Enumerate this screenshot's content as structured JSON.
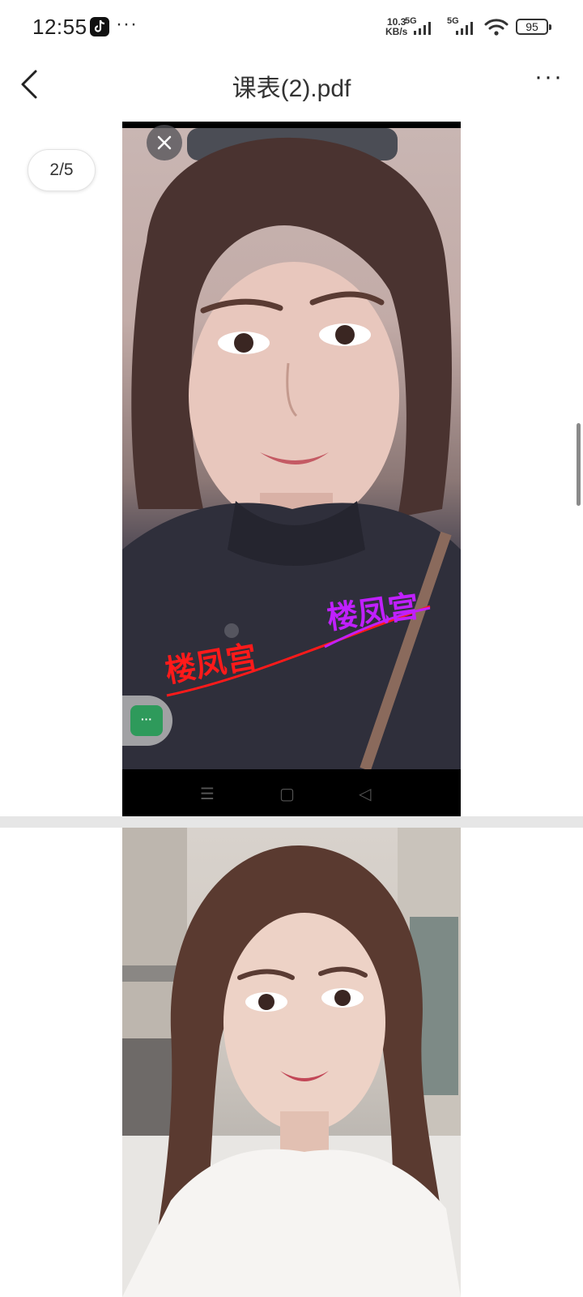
{
  "status_bar": {
    "time": "12:55",
    "more": "···",
    "net_speed_value": "10.3",
    "net_speed_unit": "KB/s",
    "sim1_label": "5G",
    "sim2_label": "5G",
    "battery": "95"
  },
  "header": {
    "title": "课表(2).pdf",
    "menu": "···"
  },
  "viewer": {
    "page_indicator": "2/5",
    "float_button": "···",
    "watermark_text": "楼凤宫",
    "colors": {
      "watermark_red": "#ff1a1a",
      "watermark_purple": "#c020ff",
      "float_green": "#2e9a5b"
    }
  },
  "icons": {
    "back": "chevron-left-icon",
    "menu": "more-horizontal-icon",
    "close": "close-icon",
    "app": "tiktok-icon",
    "wifi": "wifi-icon"
  }
}
